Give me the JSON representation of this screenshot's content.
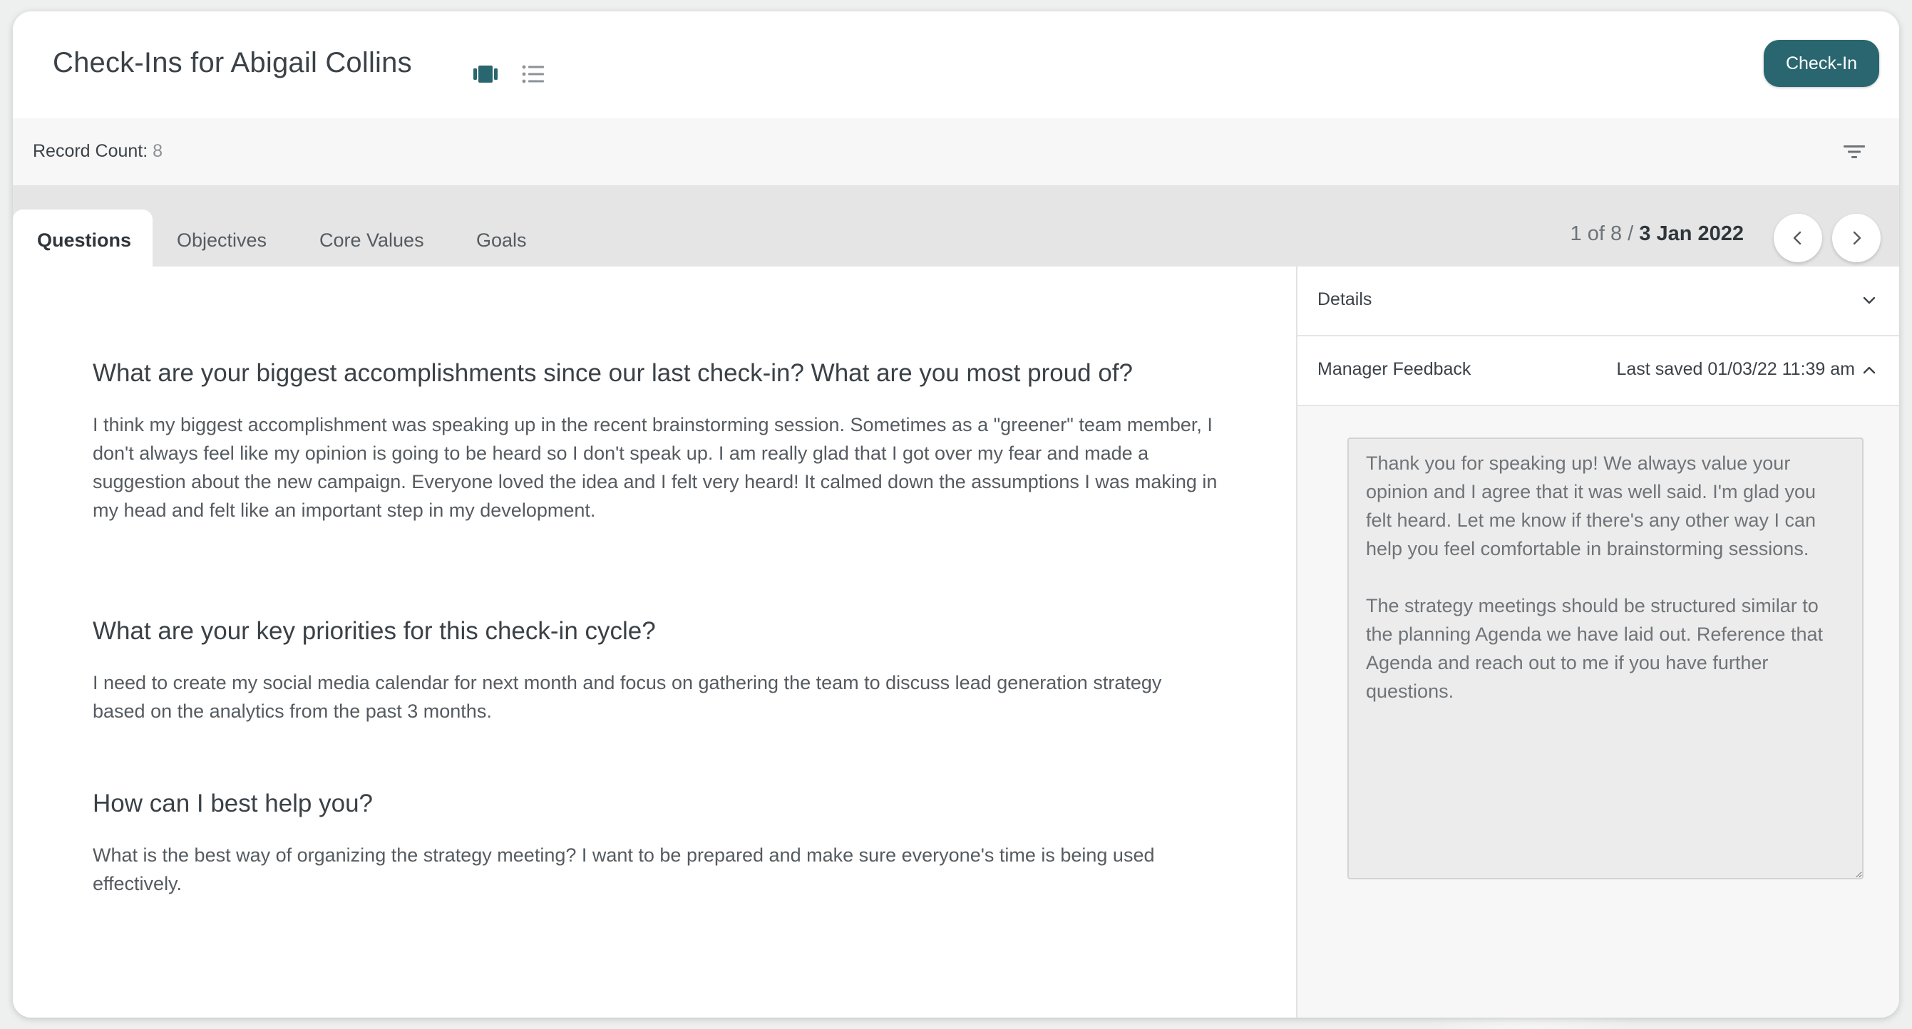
{
  "header": {
    "title": "Check-Ins for Abigail Collins",
    "carousel_view_icon": "carousel-view-icon",
    "list_view_icon": "list-view-icon",
    "checkin_label": "Check-In"
  },
  "record_bar": {
    "label": "Record Count:",
    "count": "8",
    "filter_icon": "filter-icon"
  },
  "tabs": [
    {
      "label": "Questions",
      "active": true
    },
    {
      "label": "Objectives",
      "active": false
    },
    {
      "label": "Core Values",
      "active": false
    },
    {
      "label": "Goals",
      "active": false
    }
  ],
  "pager": {
    "position": "1 of 8",
    "separator": "/",
    "date": "3 Jan 2022",
    "prev_icon": "chevron-left-icon",
    "next_icon": "chevron-right-icon"
  },
  "questions": [
    {
      "question": "What are your biggest accomplishments since our last check-in? What are you most proud of?",
      "answer": "I think my biggest accomplishment was speaking up in the recent brainstorming session. Sometimes as a \"greener\" team member, I don't always feel like my opinion is going to be heard so I don't speak up. I am really glad that I got over my fear and made a suggestion about the new campaign. Everyone loved the idea and I felt very heard! It calmed down the assumptions I was making in my head and felt like an important step in my development."
    },
    {
      "question": "What are your key priorities for this check-in cycle?",
      "answer": "I need to create my social media calendar for next month and focus on gathering the team to discuss lead generation strategy based on the analytics from the past 3 months."
    },
    {
      "question": "How can I best help you?",
      "answer": "What is the best way of organizing the strategy meeting? I want to be prepared and make sure everyone's time is being used effectively."
    }
  ],
  "side_panel": {
    "details_label": "Details",
    "details_icon": "chevron-down-icon",
    "feedback_label": "Manager Feedback",
    "last_saved": "Last saved 01/03/22 11:39 am",
    "feedback_icon": "chevron-up-icon",
    "feedback_text": "Thank you for speaking up! We always value your opinion and I agree that it was well said. I'm glad you felt heard. Let me know if there's any other way I can help you feel comfortable in brainstorming sessions.\n\nThe strategy meetings should be structured similar to the planning Agenda we have laid out. Reference that Agenda and reach out to me if you have further questions."
  },
  "colors": {
    "accent": "#2a6670",
    "tab_bar": "#e5e5e5",
    "panel_bg": "#f7f7f7"
  }
}
